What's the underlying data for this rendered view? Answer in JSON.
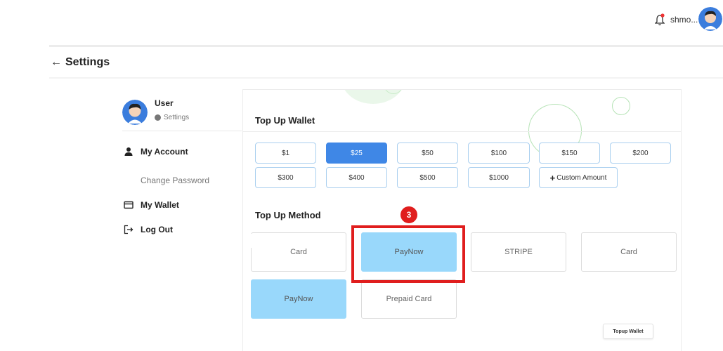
{
  "header": {
    "username": "shmo...",
    "notification_icon": "bell-icon",
    "avatar_icon": "avatar-icon"
  },
  "page": {
    "back_icon": "←",
    "title": "Settings"
  },
  "sidebar": {
    "user_name": "User",
    "user_subtitle": "Settings",
    "items": [
      {
        "label": "My Account",
        "icon": "user-icon"
      },
      {
        "label": "Change Password"
      },
      {
        "label": "My Wallet",
        "icon": "wallet-icon"
      },
      {
        "label": "Log Out",
        "icon": "logout-icon"
      }
    ]
  },
  "wallet": {
    "title": "Top Up Wallet",
    "amounts": [
      "$1",
      "$25",
      "$50",
      "$100",
      "$150",
      "$200",
      "$300",
      "$400",
      "$500",
      "$1000"
    ],
    "selected_amount": "$25",
    "custom_amount_label": "Custom Amount",
    "method_title": "Top Up Method",
    "methods": [
      "Card",
      "PayNow",
      "STRIPE",
      "Card",
      "PayNow",
      "Prepaid Card"
    ],
    "selected_method": "PayNow",
    "submit_label": "Topup Wallet"
  },
  "annotation": {
    "step": "3",
    "color": "#e01e1e"
  },
  "colors": {
    "accent": "#3f87e6",
    "selected_method_bg": "#99d8fb"
  }
}
